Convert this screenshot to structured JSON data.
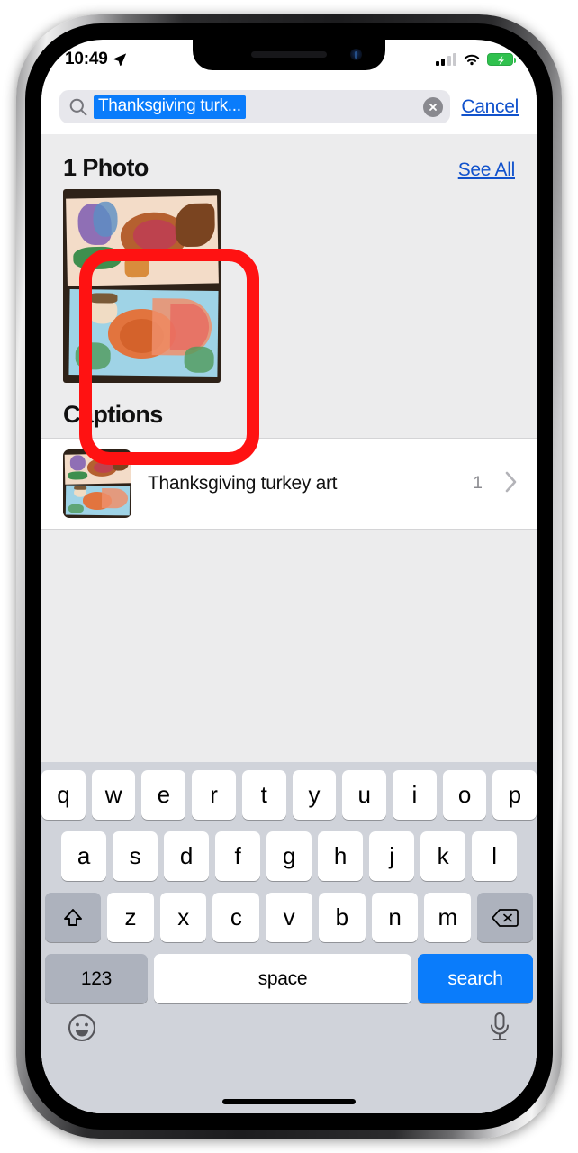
{
  "status_bar": {
    "time": "10:49",
    "location_icon": "location-arrow-icon",
    "signal_icon": "cellular-signal-icon",
    "signal_bars_filled": 2,
    "signal_bars_total": 4,
    "wifi_icon": "wifi-icon",
    "battery_icon": "battery-charging-icon"
  },
  "search": {
    "icon": "search-icon",
    "value": "Thanksgiving turk...",
    "selected": true,
    "clear_icon": "clear-circle-icon",
    "cancel_label": "Cancel"
  },
  "photos_section": {
    "title": "1 Photo",
    "see_all_label": "See All",
    "photo_alt": "turkey-artwork-photo"
  },
  "captions_section": {
    "title": "Captions",
    "rows": [
      {
        "thumbnail": "turkey-artwork-thumbnail",
        "label": "Thanksgiving turkey art",
        "count": "1",
        "chevron": "chevron-right-icon"
      }
    ]
  },
  "annotation": {
    "shape": "rounded-rectangle-highlight",
    "color": "#ff1212"
  },
  "keyboard": {
    "row1": [
      "q",
      "w",
      "e",
      "r",
      "t",
      "y",
      "u",
      "i",
      "o",
      "p"
    ],
    "row2": [
      "a",
      "s",
      "d",
      "f",
      "g",
      "h",
      "j",
      "k",
      "l"
    ],
    "row3": [
      "z",
      "x",
      "c",
      "v",
      "b",
      "n",
      "m"
    ],
    "shift_icon": "shift-arrow-icon",
    "backspace_icon": "backspace-delete-icon",
    "numbers_label": "123",
    "space_label": "space",
    "search_label": "search",
    "emoji_icon": "smiley-face-icon",
    "dictation_icon": "microphone-icon"
  },
  "colors": {
    "accent_blue": "#0a7cfb",
    "link_blue": "#1152cc",
    "annotation_red": "#ff1212",
    "keyboard_bg": "#d0d3da"
  }
}
